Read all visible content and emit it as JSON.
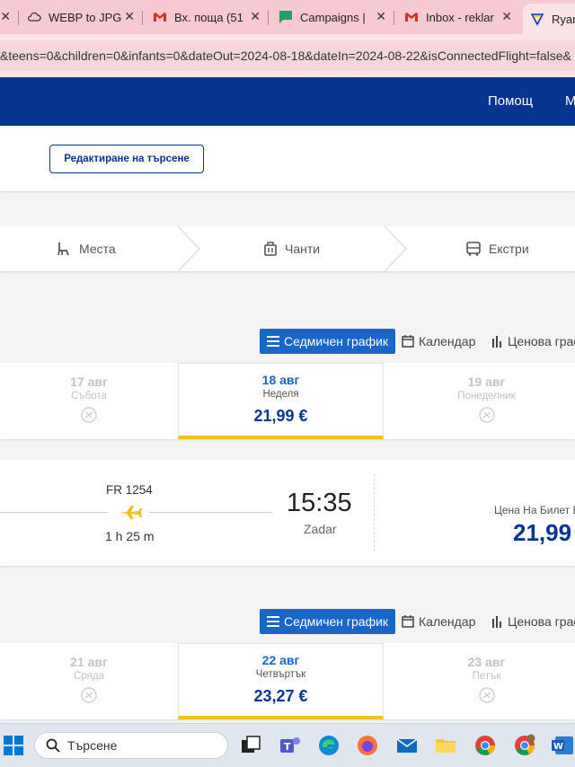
{
  "browser": {
    "tabs": [
      {
        "title": "WEBP to JPG",
        "icon": "cloud-convert-icon"
      },
      {
        "title": "Вх. поща (51",
        "icon": "gmail-icon"
      },
      {
        "title": "Campaigns |",
        "icon": "chat-bubble-icon"
      },
      {
        "title": "Inbox - reklar",
        "icon": "gmail-icon"
      },
      {
        "title": "Ryan",
        "icon": "ryanair-harp-icon"
      }
    ],
    "url": "&teens=0&children=0&infants=0&dateOut=2024-08-18&dateIn=2024-08-22&isConnectedFlight=false&"
  },
  "header": {
    "nav": [
      "Помощ",
      "М"
    ]
  },
  "search": {
    "edit_label": "Редактиране на търсене"
  },
  "steps": [
    {
      "label": "Места",
      "icon": "seat-icon"
    },
    {
      "label": "Чанти",
      "icon": "luggage-icon"
    },
    {
      "label": "Екстри",
      "icon": "bus-icon"
    }
  ],
  "view_toggle": {
    "weekly": "Седмичен график",
    "calendar": "Календар",
    "price": "Ценова граф"
  },
  "outbound": {
    "days": [
      {
        "date": "17 авг",
        "weekday": "Събота",
        "price": null
      },
      {
        "date": "18 авг",
        "weekday": "Неделя",
        "price": "21,99 €"
      },
      {
        "date": "19 авг",
        "weekday": "Понеделник",
        "price": null
      }
    ],
    "flight": {
      "number": "FR 1254",
      "duration": "1 h 25 m",
      "arrival_time": "15:35",
      "arrival_city": "Zadar",
      "price_label": "Цена На Билет В",
      "price": "21,99"
    }
  },
  "return": {
    "days": [
      {
        "date": "21 авг",
        "weekday": "Сряда",
        "price": null
      },
      {
        "date": "22 авг",
        "weekday": "Четвъртък",
        "price": "23,27 €"
      },
      {
        "date": "23 авг",
        "weekday": "Петък",
        "price": null
      }
    ]
  },
  "taskbar": {
    "search_label": "Търсене",
    "apps": [
      "windows-start-icon",
      "task-view-icon",
      "teams-icon",
      "edge-icon",
      "firefox-icon",
      "mail-icon",
      "file-explorer-icon",
      "chrome-icon",
      "chrome-profile-icon",
      "word-icon"
    ]
  },
  "colors": {
    "brand_blue": "#073590",
    "accent_blue": "#1866c7",
    "accent_yellow": "#f0c319"
  }
}
